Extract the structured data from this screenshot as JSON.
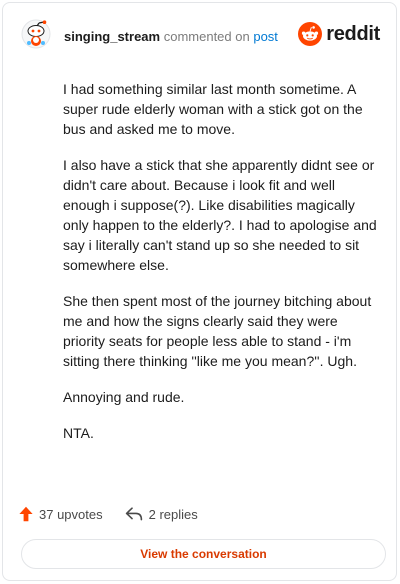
{
  "comment": {
    "username": "singing_stream",
    "action_text": "commented on",
    "post_link": "post",
    "paragraphs": [
      "I had something similar last month sometime. A super rude elderly woman with a stick got on the bus and asked me to move.",
      "I also have a stick that she apparently didnt see or didn't care about. Because i look fit and well enough i suppose(?). Like disabilities magically only happen to the elderly?. I had to apologise and say i literally can't stand up so she needed to sit somewhere else.",
      "She then spent most of the journey bitching about me and how the signs clearly said they were priority seats for people less able to stand - i'm sitting there thinking ''like me you mean?''. Ugh.",
      "Annoying and rude.",
      "NTA."
    ]
  },
  "brand": {
    "wordmark": "reddit",
    "color": "#ff4500"
  },
  "stats": {
    "upvotes": "37 upvotes",
    "replies": "2 replies",
    "upvote_color": "#ff4500"
  },
  "cta": {
    "label": "View the conversation",
    "color": "#d93a00"
  },
  "icons": {
    "avatar": "snoo-avatar-icon",
    "logo": "reddit-alien-icon",
    "upvote": "upvote-arrow-icon",
    "reply": "reply-arrow-icon"
  }
}
